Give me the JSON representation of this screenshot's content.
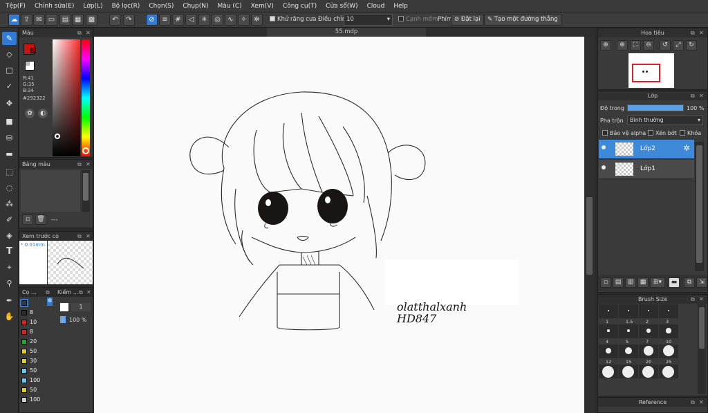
{
  "menu": [
    "Tệp(F)",
    "Chỉnh sửa(E)",
    "Lớp(L)",
    "Bộ lọc(R)",
    "Chọn(S)",
    "Chụp(N)",
    "Màu (C)",
    "Xem(V)",
    "Công cụ(T)",
    "Cửa sổ(W)",
    "Cloud",
    "Help"
  ],
  "toolbar": {
    "antialias_label": "Khử răng cưa",
    "adjust_label": "Điều chỉnh",
    "adjust_value": "10",
    "soft_edge_label": "Cạnh mềm",
    "key_label": "Phím",
    "reset_label": "Đặt lại",
    "straight_line_label": "Tạo một đường thẳng"
  },
  "color_panel": {
    "title": "Màu",
    "r": "R:41",
    "g": "G:35",
    "b": "B:34",
    "hex": "#292322",
    "fg_color": "#cc1111",
    "current_color": "#292322"
  },
  "palette_panel": {
    "title": "Bảng màu",
    "dash": "---"
  },
  "brush_preview": {
    "title": "Xem trước cọ",
    "size": "* 0.01mm"
  },
  "brush_list": {
    "tab1": "Cọ ...",
    "tab2": "Kiểm ...",
    "sizes": [
      {
        "label": "",
        "color": "#3a3a3a"
      },
      {
        "label": "8",
        "color": "#2b2b2b"
      },
      {
        "label": "10",
        "color": "#e02020"
      },
      {
        "label": "8",
        "color": "#e02020"
      },
      {
        "label": "20",
        "color": "#22aa22"
      },
      {
        "label": "50",
        "color": "#e0d020"
      },
      {
        "label": "30",
        "color": "#e0d020"
      },
      {
        "label": "50",
        "color": "#66ccff"
      },
      {
        "label": "100",
        "color": "#66ccff"
      },
      {
        "label": "50",
        "color": "#e0d020"
      },
      {
        "label": "100",
        "color": "#cccccc"
      }
    ],
    "check_value": "1",
    "opacity": "100 %"
  },
  "canvas": {
    "tab_title": "55.mdp",
    "signature_line1": "olatthalxanh",
    "signature_line2": "HD847"
  },
  "navigator": {
    "title": "Hoa tiêu"
  },
  "layers": {
    "title": "Lớp",
    "opacity_label": "Độ trong",
    "opacity_value": "100 %",
    "opacity_fraction": 1.0,
    "blend_label": "Pha trộn",
    "blend_value": "Bình thường",
    "protect_alpha": "Bảo vệ alpha",
    "clipping": "Xén bớt",
    "lock": "Khóa",
    "items": [
      {
        "name": "Lớp2",
        "selected": true
      },
      {
        "name": "Lớp1",
        "selected": false
      }
    ]
  },
  "brush_size": {
    "title": "Brush Size",
    "labels": [
      "1",
      "1.5",
      "2",
      "3",
      "4",
      "5",
      "7",
      "10",
      "12",
      "15",
      "20",
      "25"
    ]
  },
  "reference": {
    "title": "Reference"
  }
}
